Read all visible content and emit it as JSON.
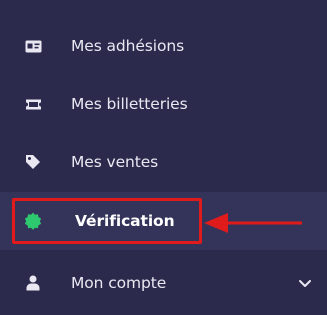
{
  "nav": {
    "items": [
      {
        "label": "Mes adhésions",
        "icon": "membership-card-icon"
      },
      {
        "label": "Mes billetteries",
        "icon": "ticket-icon"
      },
      {
        "label": "Mes ventes",
        "icon": "tag-icon"
      },
      {
        "label": "Vérification",
        "icon": "verification-badge-icon",
        "active": true
      },
      {
        "label": "Mon compte",
        "icon": "user-icon",
        "has_submenu": true
      }
    ]
  },
  "colors": {
    "sidebar_bg": "#2b2a4c",
    "active_bg": "#34335a",
    "text": "#e9e8f2",
    "verification_icon": "#2ec96e",
    "annotation_red": "#e01b1b"
  }
}
